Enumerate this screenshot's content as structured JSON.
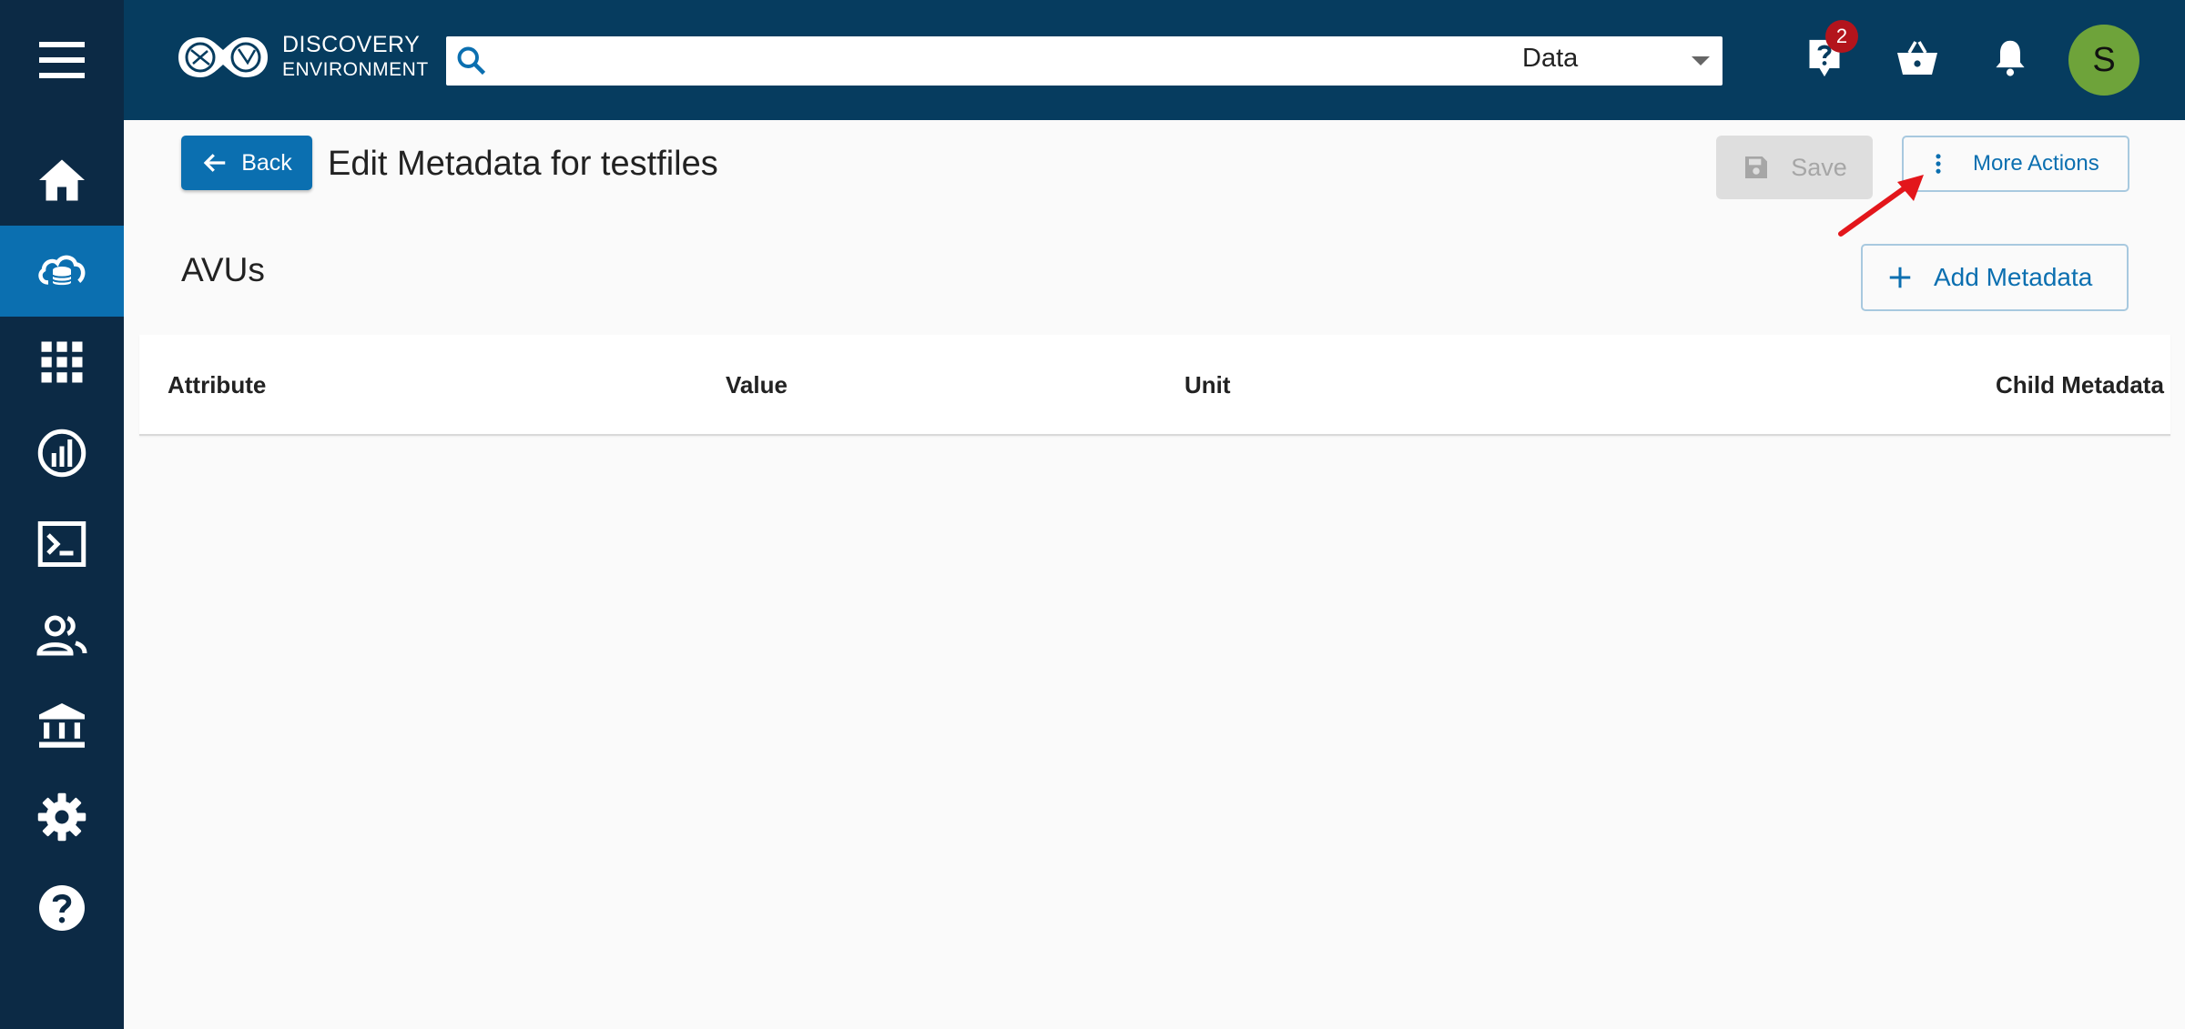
{
  "app": {
    "logo_line1": "DISCOVERY",
    "logo_line2": "ENVIRONMENT"
  },
  "search": {
    "value": "",
    "placeholder": "",
    "scope": "Data"
  },
  "header": {
    "help_badge_count": "2",
    "avatar_initial": "S"
  },
  "toolbar": {
    "back_label": "Back",
    "title": "Edit Metadata for testfiles",
    "save_label": "Save",
    "more_actions_label": "More Actions"
  },
  "section": {
    "title": "AVUs",
    "add_label": "Add Metadata"
  },
  "table": {
    "columns": [
      "Attribute",
      "Value",
      "Unit",
      "Child Metadata"
    ]
  },
  "sidebar": {
    "items": [
      {
        "icon": "menu-icon"
      },
      {
        "icon": "home-icon"
      },
      {
        "icon": "data-icon",
        "active": true
      },
      {
        "icon": "apps-icon"
      },
      {
        "icon": "analyses-icon"
      },
      {
        "icon": "terminal-icon"
      },
      {
        "icon": "teams-icon"
      },
      {
        "icon": "collections-icon"
      },
      {
        "icon": "settings-icon"
      },
      {
        "icon": "help-icon"
      }
    ]
  },
  "colors": {
    "sidebar_bg": "#0c2a45",
    "topbar_bg": "#063c5f",
    "accent": "#0b6fb0",
    "badge": "#b3141c",
    "avatar": "#6ea33a",
    "annotation_arrow": "#e3161b"
  }
}
